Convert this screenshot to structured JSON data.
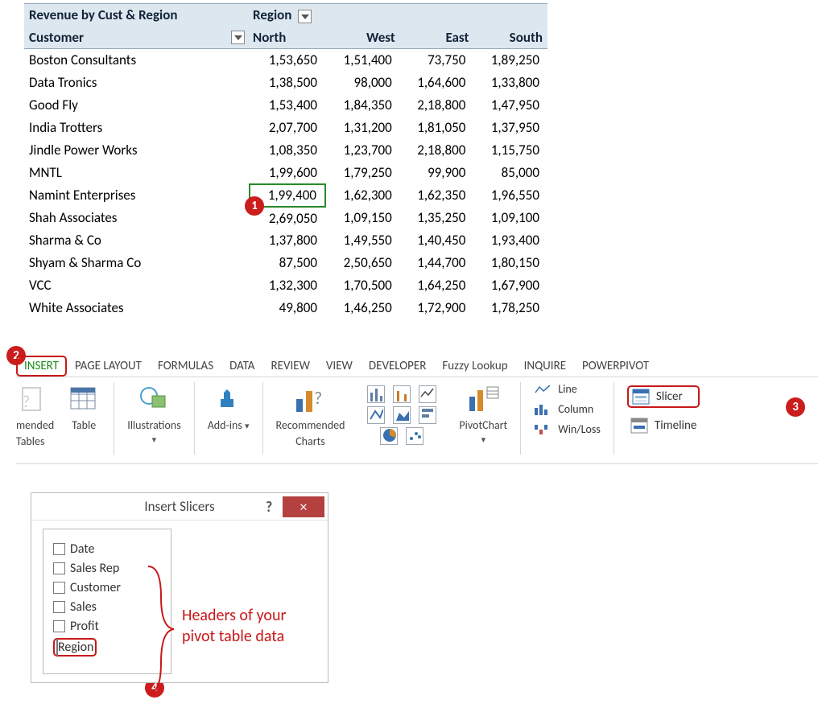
{
  "pivot": {
    "title": "Revenue by Cust & Region",
    "filter_label": "Region",
    "row_header": "Customer",
    "columns": [
      "North",
      "West",
      "East",
      "South"
    ],
    "rows": [
      {
        "name": "Boston Consultants",
        "vals": [
          "1,53,650",
          "1,51,400",
          "73,750",
          "1,89,250"
        ]
      },
      {
        "name": "Data Tronics",
        "vals": [
          "1,38,500",
          "98,000",
          "1,64,600",
          "1,33,800"
        ]
      },
      {
        "name": "Good Fly",
        "vals": [
          "1,53,400",
          "1,84,350",
          "2,18,800",
          "1,47,950"
        ]
      },
      {
        "name": "India Trotters",
        "vals": [
          "2,07,700",
          "1,31,200",
          "1,81,050",
          "1,37,950"
        ]
      },
      {
        "name": "Jindle Power Works",
        "vals": [
          "1,08,350",
          "1,23,700",
          "2,18,800",
          "1,15,750"
        ]
      },
      {
        "name": "MNTL",
        "vals": [
          "1,99,600",
          "1,79,250",
          "99,900",
          "85,000"
        ]
      },
      {
        "name": "Namint Enterprises",
        "vals": [
          "1,99,400",
          "1,62,300",
          "1,62,350",
          "1,96,550"
        ]
      },
      {
        "name": "Shah Associates",
        "vals": [
          "2,69,050",
          "1,09,150",
          "1,35,250",
          "1,09,100"
        ]
      },
      {
        "name": "Sharma & Co",
        "vals": [
          "1,37,800",
          "1,49,550",
          "1,40,450",
          "1,93,400"
        ]
      },
      {
        "name": "Shyam & Sharma Co",
        "vals": [
          "87,500",
          "2,50,650",
          "1,44,700",
          "1,80,150"
        ]
      },
      {
        "name": "VCC",
        "vals": [
          "1,32,300",
          "1,70,500",
          "1,64,250",
          "1,67,900"
        ]
      },
      {
        "name": "White Associates",
        "vals": [
          "49,800",
          "1,46,250",
          "1,72,900",
          "1,78,250"
        ]
      }
    ],
    "selected_cell": {
      "row": 6,
      "col": 0
    }
  },
  "ribbon": {
    "tabs": [
      "INSERT",
      "PAGE LAYOUT",
      "FORMULAS",
      "DATA",
      "REVIEW",
      "VIEW",
      "DEVELOPER",
      "Fuzzy Lookup",
      "INQUIRE",
      "POWERPIVOT"
    ],
    "active_tab": "INSERT",
    "left_faded": [
      "mended",
      "Tables"
    ],
    "table_label": "Table",
    "illustrations_label": "Illustrations",
    "addins_label": "Add-ins",
    "recommended_charts": [
      "Recommended",
      "Charts"
    ],
    "pivotchart_label": "PivotChart",
    "sparklines": [
      "Line",
      "Column",
      "Win/Loss"
    ],
    "filters": [
      "Slicer",
      "Timeline"
    ]
  },
  "dialog": {
    "title": "Insert Slicers",
    "fields": [
      "Date",
      "Sales Rep",
      "Customer",
      "Sales",
      "Profit",
      "Region"
    ]
  },
  "annotation": {
    "text1": "Headers of your",
    "text2": "pivot table data"
  },
  "callouts": [
    "1",
    "2",
    "3",
    "4"
  ]
}
